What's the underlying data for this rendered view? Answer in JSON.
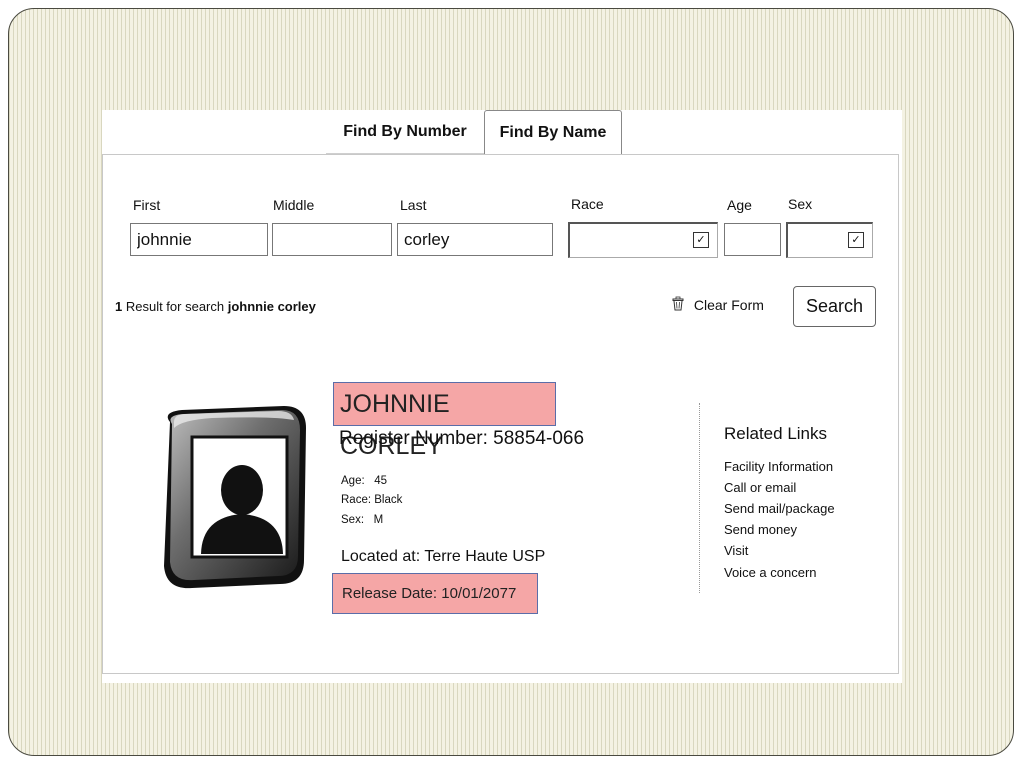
{
  "tabs": {
    "find_by_number": "Find By Number",
    "find_by_name": "Find By Name"
  },
  "form": {
    "first_label": "First",
    "first_value": "johnnie",
    "middle_label": "Middle",
    "middle_value": "",
    "last_label": "Last",
    "last_value": "corley",
    "race_label": "Race",
    "race_value": "",
    "age_label": "Age",
    "age_value": "",
    "sex_label": "Sex",
    "sex_value": ""
  },
  "results": {
    "count": "1",
    "text": " Result for search ",
    "query": "johnnie corley"
  },
  "actions": {
    "clear_form": "Clear Form",
    "search": "Search"
  },
  "inmate": {
    "name": "JOHNNIE CORLEY",
    "register": "Register Number: 58854-066",
    "age_label": "Age:",
    "age": "45",
    "race_label": "Race:",
    "race": "Black",
    "sex_label": "Sex:",
    "sex": "M",
    "located_label": "Located at:",
    "located": "Terre Haute USP",
    "release": "Release Date: 10/01/2077"
  },
  "related": {
    "title": "Related Links",
    "links": [
      "Facility Information",
      "Call or email",
      "Send mail/package",
      "Send money",
      "Visit",
      "Voice a concern"
    ]
  },
  "colors": {
    "highlight": "#f5a6a6",
    "highlight_border": "#5b6da8",
    "slide_background": "#f4f2e3"
  },
  "icons": {
    "dropdown": "chevron-down-icon",
    "clear": "trash-icon",
    "avatar": "person-silhouette-icon"
  }
}
